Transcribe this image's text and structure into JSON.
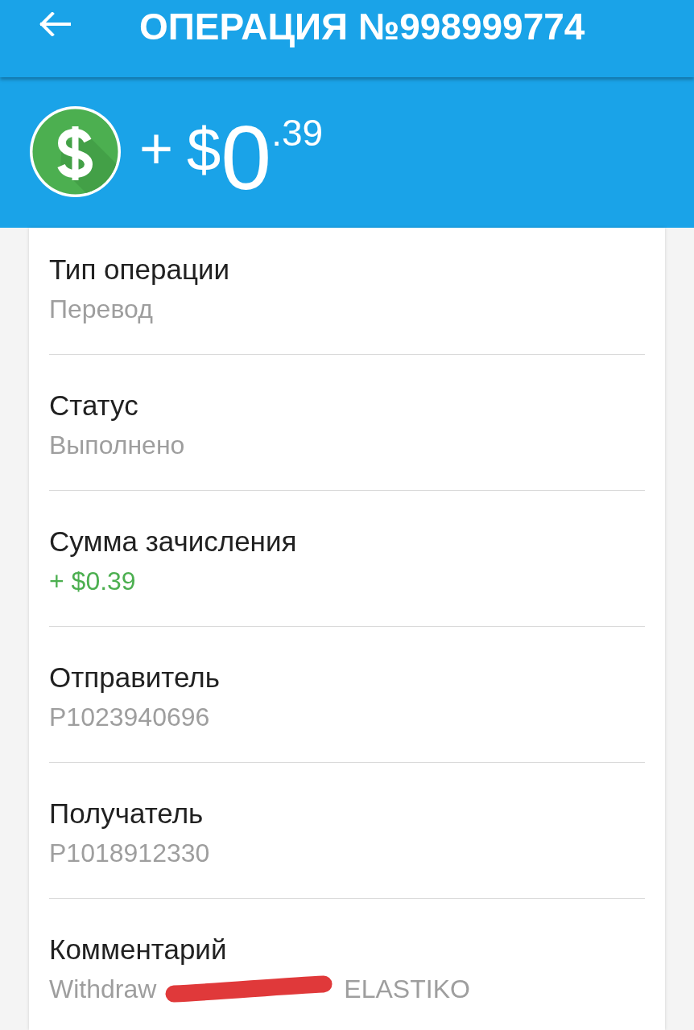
{
  "app_bar": {
    "title": "ОПЕРАЦИЯ №998999774"
  },
  "amount": {
    "sign": "+",
    "currency": "$",
    "integer": "0",
    "fraction": ".39"
  },
  "details": [
    {
      "label": "Тип операции",
      "kind": "text",
      "value": "Перевод"
    },
    {
      "label": "Статус",
      "kind": "text",
      "value": "Выполнено"
    },
    {
      "label": "Сумма зачисления",
      "kind": "credit",
      "value": "+ $0.39"
    },
    {
      "label": "Отправитель",
      "kind": "text",
      "value": "P1023940696"
    },
    {
      "label": "Получатель",
      "kind": "text",
      "value": "P1018912330"
    },
    {
      "label": "Комментарий",
      "kind": "segments",
      "segments": [
        {
          "kind": "text",
          "text": "Withdraw"
        },
        {
          "kind": "redaction"
        },
        {
          "kind": "text",
          "text": "ELASTIKO"
        }
      ]
    }
  ]
}
